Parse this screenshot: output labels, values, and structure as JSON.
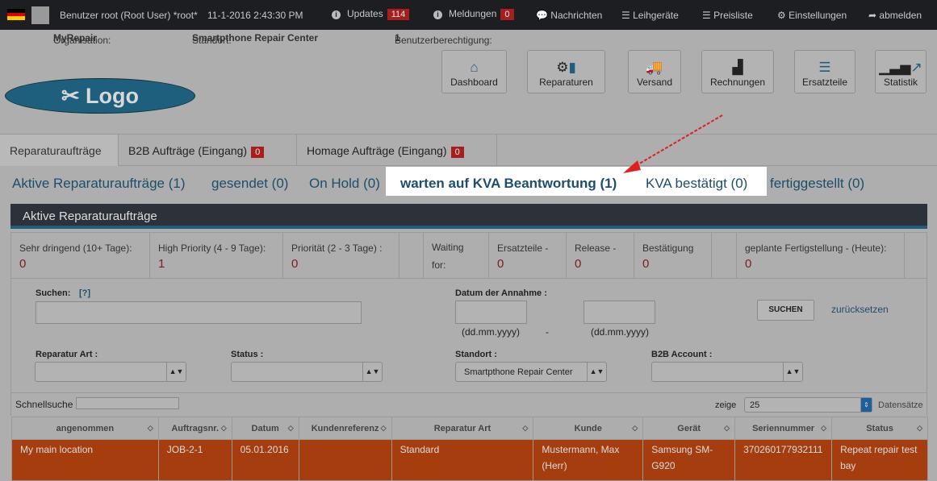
{
  "topbar": {
    "user": "Benutzer root (Root User) *root*",
    "datetime": "11-1-2016 2:43:30 PM",
    "updates": "Updates",
    "updates_count": "114",
    "meldungen": "Meldungen",
    "meldungen_count": "0",
    "nachrichten": "Nachrichten",
    "leihgeraete": "Leihgeräte",
    "preisliste": "Preisliste",
    "einstellungen": "Einstellungen",
    "abmelden": "abmelden"
  },
  "org": {
    "org_label": "Organisation:",
    "org": "MyRepair",
    "standort_label": "Standort:",
    "standort": "Smartpthone Repair Center",
    "perm_label": "Benutzerberechtigung:",
    "perm": "1"
  },
  "logo": "✂ Logo",
  "nav": [
    "Dashboard",
    "Reparaturen",
    "Versand",
    "Rechnungen",
    "Ersatzteile",
    "Statistik"
  ],
  "tabs": [
    {
      "label": "Reparaturaufträge"
    },
    {
      "label": "B2B Aufträge (Eingang)",
      "count": "0"
    },
    {
      "label": "Homage Aufträge (Eingang)",
      "count": "0"
    }
  ],
  "crumbs": [
    "Aktive Reparaturaufträge (1)",
    "gesendet (0)",
    "On Hold (0)",
    "warten auf KVA Beantwortung (1)",
    "KVA bestätigt (0)",
    "fertiggestellt (0)"
  ],
  "panel_title": "Aktive Reparaturaufträge",
  "stats": [
    {
      "label": "Sehr dringend (10+ Tage):",
      "value": "0"
    },
    {
      "label": "High Priority (4 - 9 Tage):",
      "value": "1"
    },
    {
      "label": "Priorität (2 - 3 Tage) :",
      "value": "0"
    },
    {
      "label": "Waiting for:",
      "value": ""
    },
    {
      "label": "Ersatzteile -",
      "value": "0"
    },
    {
      "label": "Release -",
      "value": "0"
    },
    {
      "label": "Bestätigung",
      "value": "0"
    },
    {
      "label": "geplante Fertigstellung - (Heute):",
      "value": "0"
    }
  ],
  "filters": {
    "suchen": "Suchen:",
    "help": "[?]",
    "datum": "Datum der Annahme :",
    "date_hint": "(dd.mm.yyyy)",
    "dash": "-",
    "suchen_btn": "SUCHEN",
    "reset": "zurücksetzen",
    "reparatur_art": "Reparatur Art :",
    "status": "Status :",
    "standort": "Standort :",
    "standort_value": "Smartpthone Repair Center",
    "b2b": "B2B Account :"
  },
  "table": {
    "schnellsuche": "Schnellsuche",
    "zeige": "zeige",
    "page_size": "25",
    "datensaetze": "Datensätze",
    "columns": [
      "angenommen",
      "Auftragsnr.",
      "Datum",
      "Kundenreferenz",
      "Reparatur Art",
      "Kunde",
      "Gerät",
      "Seriennummer",
      "Status"
    ],
    "rows": [
      [
        "My main location",
        "JOB-2-1",
        "05.01.2016",
        "",
        "Standard",
        "Mustermann, Max (Herr)",
        "Samsung SM-G920",
        "370260177932111",
        "Repeat repair test bay"
      ]
    ]
  },
  "colors": {
    "accent": "#1d5f7d",
    "row": "#a53d0f",
    "badge": "#a81d1d",
    "arrow": "#e02020"
  }
}
